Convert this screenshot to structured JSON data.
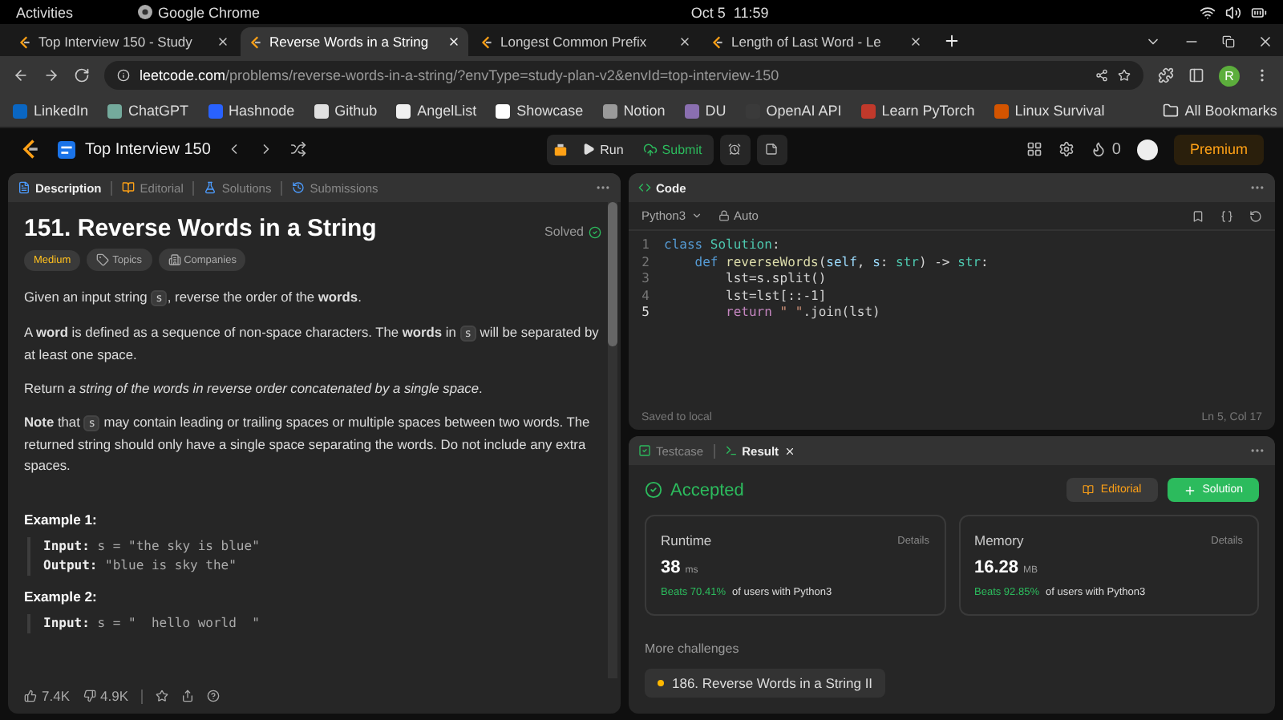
{
  "system_bar": {
    "activities": "Activities",
    "app": "Google Chrome",
    "clock": "Oct 5  11:59"
  },
  "browser": {
    "tabs": [
      {
        "title": "Top Interview 150 - Study",
        "selected": false
      },
      {
        "title": "Reverse Words in a String",
        "selected": true
      },
      {
        "title": "Longest Common Prefix",
        "selected": false
      },
      {
        "title": "Length of Last Word - Le",
        "selected": false
      }
    ],
    "url": {
      "host": "leetcode.com",
      "path": "/problems/reverse-words-in-a-string/?envType=study-plan-v2&envId=top-interview-150"
    },
    "profile": "R",
    "bookmarks": [
      {
        "label": "LinkedIn",
        "color": "#0a66c2"
      },
      {
        "label": "ChatGPT",
        "color": "#74aa9c"
      },
      {
        "label": "Hashnode",
        "color": "#2962ff"
      },
      {
        "label": "Github",
        "color": "#e0e0e0"
      },
      {
        "label": "AngelList",
        "color": "#f0f0f0"
      },
      {
        "label": "Showcase",
        "color": "#ffffff"
      },
      {
        "label": "Notion",
        "color": "#9a9a9a"
      },
      {
        "label": "DU",
        "color": "#8a6fb0"
      },
      {
        "label": "OpenAI API",
        "color": "#3a3a3a"
      },
      {
        "label": "Learn PyTorch",
        "color": "#c0392b"
      },
      {
        "label": "Linux Survival",
        "color": "#d35400"
      }
    ],
    "all_bookmarks": "All Bookmarks"
  },
  "nav": {
    "list_title": "Top Interview 150",
    "run": "Run",
    "submit": "Submit",
    "streak": "0",
    "premium": "Premium"
  },
  "description": {
    "tabs": [
      {
        "label": "Description",
        "selected": true
      },
      {
        "label": "Editorial",
        "selected": false
      },
      {
        "label": "Solutions",
        "selected": false
      },
      {
        "label": "Submissions",
        "selected": false
      }
    ],
    "title": "151. Reverse Words in a String",
    "status": "Solved",
    "tags": [
      {
        "label": "Medium",
        "kind": "difficulty"
      },
      {
        "label": "Topics",
        "kind": "topics"
      },
      {
        "label": "Companies",
        "kind": "companies"
      }
    ],
    "paragraphs": [
      [
        {
          "kind": "text",
          "text": "Given an input string "
        },
        {
          "kind": "code",
          "text": "s"
        },
        {
          "kind": "text",
          "text": ", reverse the order of the **words**."
        }
      ],
      [
        {
          "kind": "text",
          "text": "A **word** is defined as a sequence of non-space characters. The **words** in "
        },
        {
          "kind": "code",
          "text": "s"
        },
        {
          "kind": "text",
          "text": " will be separated by at least one space."
        }
      ],
      [
        {
          "kind": "text",
          "text": "Return *a string of the words in reverse order concatenated by a single space*."
        }
      ],
      [
        {
          "kind": "text",
          "text": "**Note** that "
        },
        {
          "kind": "code",
          "text": "s"
        },
        {
          "kind": "text",
          "text": " may contain leading or trailing spaces or multiple spaces between two words. The returned string should only have a single space separating the words. Do not include any extra spaces."
        }
      ]
    ],
    "examples": [
      {
        "title": "Example 1:",
        "lines": [
          {
            "label": "Input:",
            "value": "s = \"the sky is blue\""
          },
          {
            "label": "Output:",
            "value": "\"blue is sky the\""
          }
        ]
      },
      {
        "title": "Example 2:",
        "lines": [
          {
            "label": "Input:",
            "value": "s = \"  hello world  \""
          }
        ]
      }
    ],
    "likes": "7.4K",
    "dislikes": "4.9K"
  },
  "code": {
    "title": "Code",
    "language": "Python3",
    "mode": "Auto",
    "lines": [
      {
        "num": "1",
        "tokens": [
          {
            "kind": "keyword",
            "text": "class "
          },
          {
            "kind": "type",
            "text": "Solution"
          },
          {
            "kind": "plain",
            "text": ":"
          }
        ]
      },
      {
        "num": "2",
        "tokens": [
          {
            "kind": "keyword",
            "text": "    def "
          },
          {
            "kind": "func",
            "text": "reverseWords"
          },
          {
            "kind": "plain",
            "text": "("
          },
          {
            "kind": "param",
            "text": "self"
          },
          {
            "kind": "plain",
            "text": ", "
          },
          {
            "kind": "param",
            "text": "s"
          },
          {
            "kind": "plain",
            "text": ": "
          },
          {
            "kind": "type",
            "text": "str"
          },
          {
            "kind": "plain",
            "text": ") -> "
          },
          {
            "kind": "type",
            "text": "str"
          },
          {
            "kind": "plain",
            "text": ":"
          }
        ]
      },
      {
        "num": "3",
        "tokens": [
          {
            "kind": "plain",
            "text": "        lst=s.split()"
          }
        ]
      },
      {
        "num": "4",
        "tokens": [
          {
            "kind": "plain",
            "text": "        lst=lst[::-1]"
          }
        ]
      },
      {
        "num": "5",
        "tokens": [
          {
            "kind": "control",
            "text": "        return "
          },
          {
            "kind": "string",
            "text": "\" \""
          },
          {
            "kind": "plain",
            "text": ".join(lst)"
          }
        ]
      }
    ],
    "saved": "Saved to local",
    "cursor": "Ln 5, Col 17"
  },
  "result": {
    "tabs": [
      {
        "label": "Testcase",
        "selected": false
      },
      {
        "label": "Result",
        "selected": true
      }
    ],
    "status": "Accepted",
    "editorial": "Editorial",
    "solution": "Solution",
    "cards": [
      {
        "title": "Runtime",
        "details": "Details",
        "value": "38",
        "unit": "ms",
        "beats": "Beats 70.41%",
        "rest": "of users with Python3"
      },
      {
        "title": "Memory",
        "details": "Details",
        "value": "16.28",
        "unit": "MB",
        "beats": "Beats 92.85%",
        "rest": "of users with Python3"
      }
    ],
    "more_title": "More challenges",
    "challenges": [
      {
        "label": "186. Reverse Words in a String II"
      }
    ]
  }
}
